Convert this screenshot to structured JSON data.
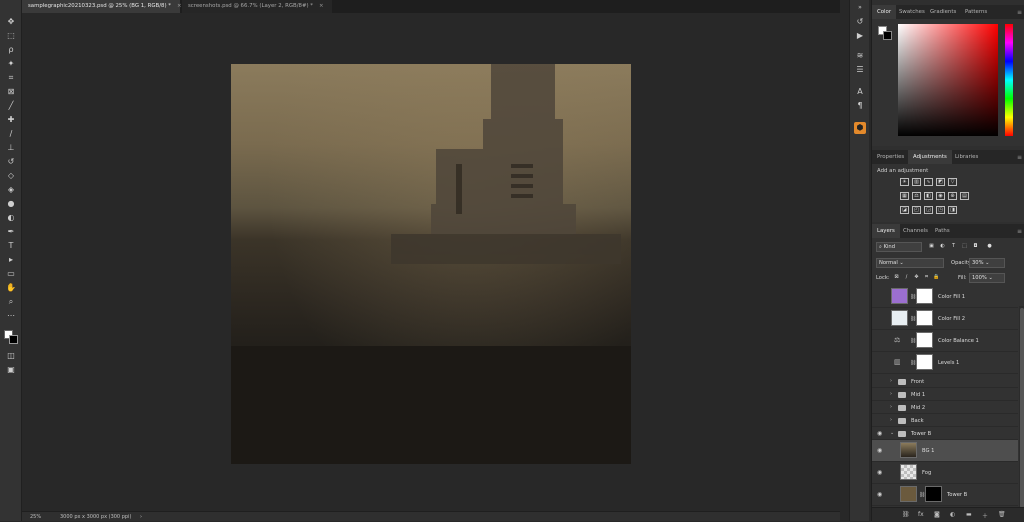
{
  "tabs": [
    {
      "label": "samplegraphic20210323.psd @ 25% (BG 1, RGB/8) *",
      "close": "×"
    },
    {
      "label": "screenshots.psd @ 66.7% (Layer 2, RGB/8#) *",
      "close": "×"
    }
  ],
  "status": {
    "zoom": "25%",
    "doc_info": "3000 px x 3000 px (300 ppi)",
    "arrow": "›"
  },
  "color_panel": {
    "tabs": [
      "Color",
      "Swatches",
      "Gradients",
      "Patterns"
    ],
    "active": "Color",
    "fg": "#ffffff",
    "bg": "#000000"
  },
  "adjustments_panel": {
    "tabs": [
      "Properties",
      "Adjustments",
      "Libraries"
    ],
    "active": "Adjustments",
    "title": "Add an adjustment"
  },
  "layers_panel": {
    "tabs": [
      "Layers",
      "Channels",
      "Paths"
    ],
    "active": "Layers",
    "filter": "Kind",
    "blend_mode": "Normal",
    "opacity_label": "Opacity:",
    "opacity": "30%",
    "lock_label": "Lock:",
    "fill_label": "Fill:",
    "fill": "100%",
    "layers": [
      {
        "name": "Color Fill 1",
        "kind": "fill",
        "thumb": "#9b6fd0"
      },
      {
        "name": "Color Fill 2",
        "kind": "fill",
        "thumb": "#e8eef2"
      },
      {
        "name": "Color Balance 1",
        "kind": "adjust"
      },
      {
        "name": "Levels 1",
        "kind": "adjust"
      },
      {
        "name": "Front",
        "kind": "group"
      },
      {
        "name": "Mid 1",
        "kind": "group"
      },
      {
        "name": "Mid 2",
        "kind": "group"
      },
      {
        "name": "Back",
        "kind": "group"
      },
      {
        "name": "Tower B",
        "kind": "group-open"
      },
      {
        "name": "BG 1",
        "kind": "pixel",
        "selected": true
      },
      {
        "name": "Fog",
        "kind": "pixel"
      },
      {
        "name": "Tower B",
        "kind": "pixel-mask"
      }
    ]
  }
}
